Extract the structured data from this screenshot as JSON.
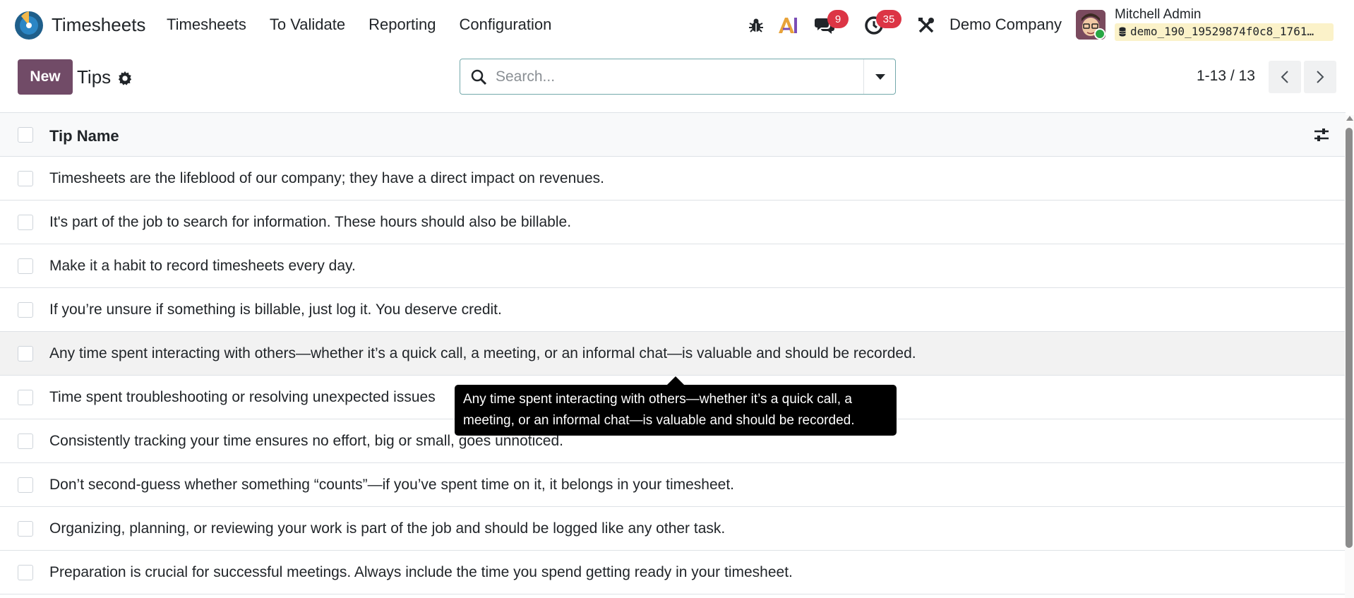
{
  "navbar": {
    "app_name": "Timesheets",
    "menu": [
      "Timesheets",
      "To Validate",
      "Reporting",
      "Configuration"
    ],
    "messages_badge": "9",
    "activities_badge": "35",
    "company": "Demo Company",
    "user_name": "Mitchell Admin",
    "database": "demo_190_19529874f0c8_1761…"
  },
  "control_panel": {
    "new_label": "New",
    "title": "Tips",
    "search_placeholder": "Search...",
    "pager": "1-13 / 13"
  },
  "list": {
    "column_header": "Tip Name",
    "rows": [
      "Timesheets are the lifeblood of our company; they have a direct impact on revenues.",
      "It's part of the job to search for information. These hours should also be billable.",
      "Make it a habit to record timesheets every day.",
      "If you’re unsure if something is billable, just log it. You deserve credit.",
      "Any time spent interacting with others—whether it’s a quick call, a meeting, or an informal chat—is valuable and should be recorded.",
      "Time spent troubleshooting or resolving unexpected issues",
      "Consistently tracking your time ensures no effort, big or small, goes unnoticed.",
      "Don’t second-guess whether something “counts”—if you’ve spent time on it, it belongs in your timesheet.",
      "Organizing, planning, or reviewing your work is part of the job and should be logged like any other task.",
      "Preparation is crucial for successful meetings. Always include the time you spend getting ready in your timesheet."
    ],
    "hovered_row": 4
  },
  "tooltip": {
    "line1": "Any time spent interacting with others—whether it’s a quick call, a",
    "line2": "meeting, or an informal chat—is valuable and should be recorded."
  },
  "colors": {
    "brand": "#714b67",
    "badge": "#dc3545",
    "search_border": "#74a9ab",
    "db_chip": "#fbf2c9",
    "online": "#28a745"
  },
  "icons": [
    "app-logo-icon",
    "bug-icon",
    "ai-icon",
    "chat-icon",
    "clock-icon",
    "tools-icon",
    "database-icon",
    "gear-icon",
    "search-icon",
    "caret-down-icon",
    "chevron-left-icon",
    "chevron-right-icon",
    "sliders-icon"
  ]
}
